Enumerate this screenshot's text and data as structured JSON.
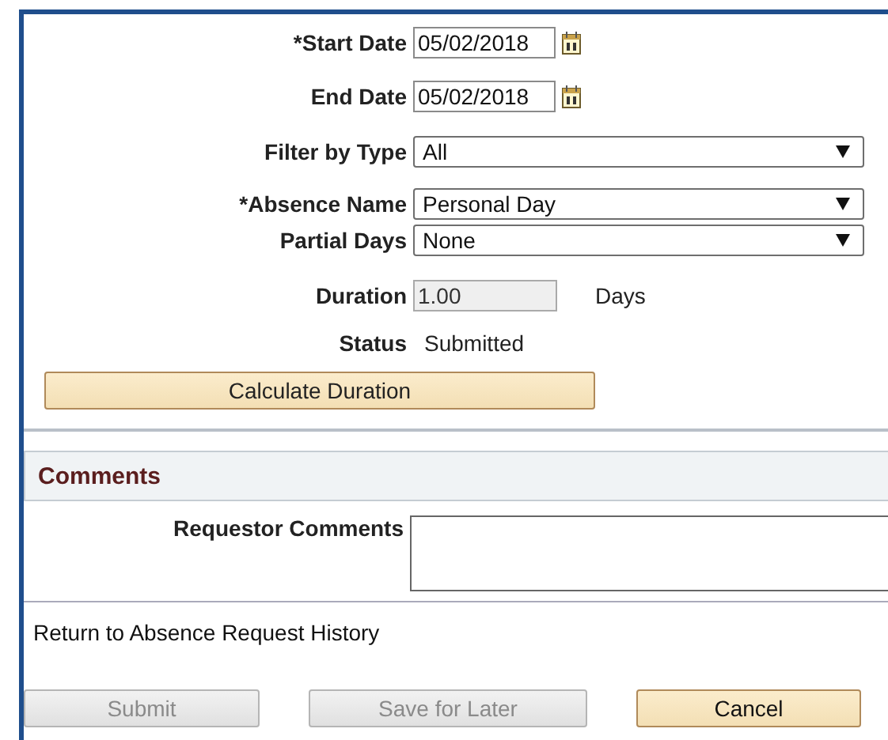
{
  "fields": [
    {
      "kind": "date",
      "label": "*Start Date",
      "value": "05/02/2018"
    },
    {
      "kind": "date",
      "label": "End Date",
      "value": "05/02/2018"
    },
    {
      "kind": "select",
      "label": "Filter by Type",
      "value": "All"
    },
    {
      "kind": "select",
      "label": "*Absence Name",
      "value": "Personal Day"
    },
    {
      "kind": "select",
      "label": "Partial Days",
      "value": "None"
    },
    {
      "kind": "readonly",
      "label": "Duration",
      "value": "1.00",
      "unit": "Days"
    },
    {
      "kind": "text",
      "label": "Status",
      "value": "Submitted"
    }
  ],
  "calculate_button": "Calculate Duration",
  "comments": {
    "title": "Comments",
    "label": "Requestor Comments"
  },
  "link": "Return to Absence Request History",
  "buttons": [
    {
      "label": "Submit",
      "disabled": true
    },
    {
      "label": "Save for Later",
      "disabled": true
    },
    {
      "label": "Cancel",
      "disabled": false
    }
  ]
}
